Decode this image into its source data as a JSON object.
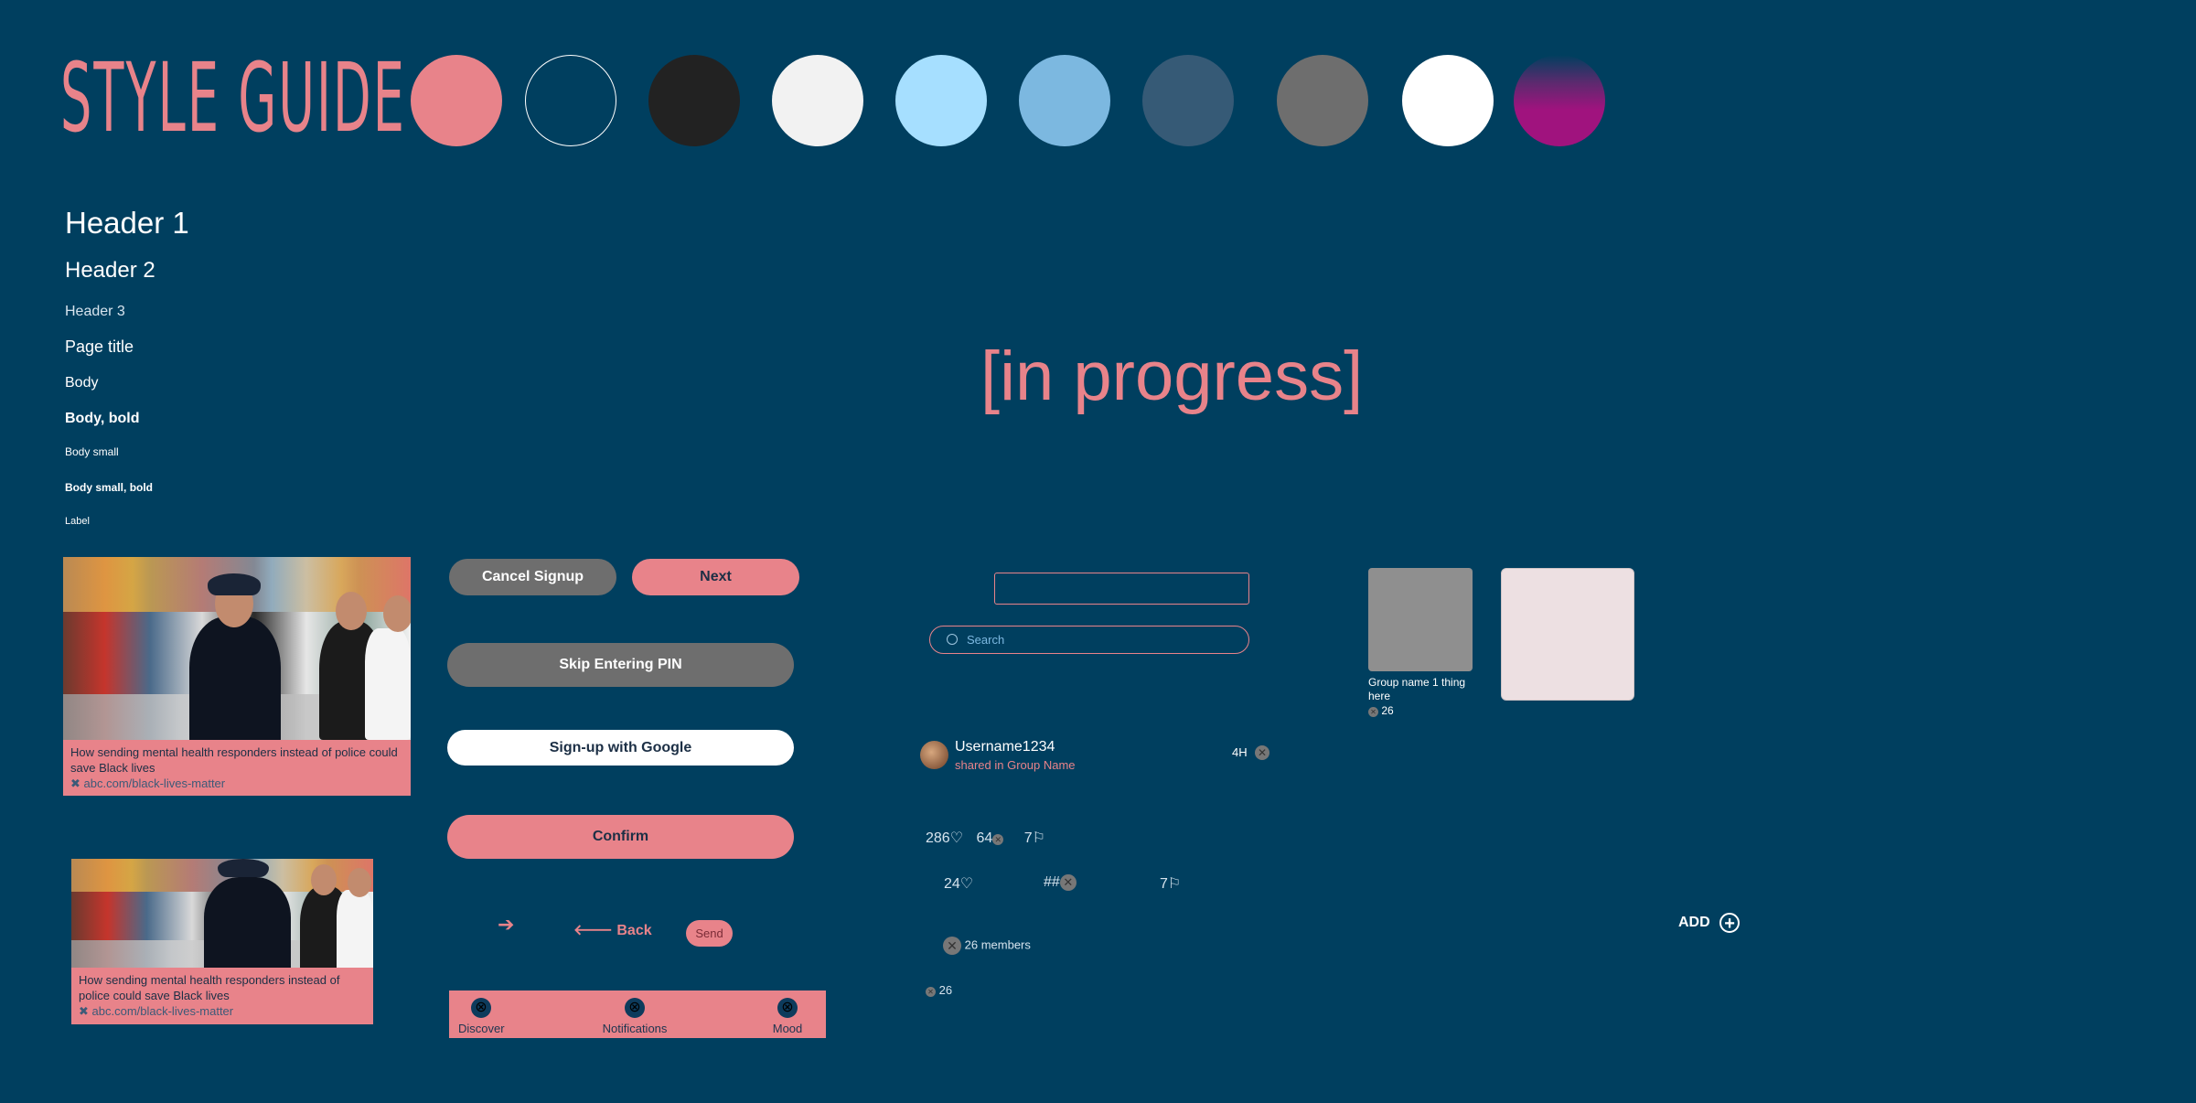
{
  "header": {
    "title": "STYLE GUIDE"
  },
  "palette": [
    "#E8838A",
    "#003F5F",
    "#222222",
    "#F2F2F2",
    "#A6DFFF",
    "#7CB8E0",
    "#365A76",
    "#6E6E6E",
    "#FFFFFF",
    "gradient:#003F5F-#A0137E"
  ],
  "typography": {
    "header1": "Header 1",
    "header2": "Header 2",
    "header3": "Header 3",
    "page_title": "Page title",
    "body": "Body",
    "body_bold": "Body, bold",
    "body_small": "Body small",
    "body_small_bold": "Body small, bold",
    "label": "Label"
  },
  "status": {
    "text": "[in progress]"
  },
  "article_card": {
    "headline": "How sending mental health responders instead of police could save Black lives",
    "link": "abc.com/black-lives-matter"
  },
  "buttons": {
    "cancel_signup": "Cancel Signup",
    "next": "Next",
    "skip_pin": "Skip Entering PIN",
    "google": "Sign-up with Google",
    "confirm": "Confirm",
    "back": "Back",
    "send": "Send",
    "add": "ADD"
  },
  "search": {
    "placeholder": "Search"
  },
  "post": {
    "username": "Username1234",
    "shared_in": "shared in Group Name",
    "time": "4H",
    "likes": "286",
    "comments": "64",
    "saves": "7",
    "row2_likes": "24",
    "row2_tags": "##",
    "row2_saves": "7"
  },
  "group": {
    "name": "Group name 1 thing here",
    "count": "26",
    "members": "26 members"
  },
  "tabs": [
    "Discover",
    "Notifications",
    "Mood"
  ],
  "colors": {
    "accent": "#E8838A",
    "background": "#003F5F",
    "button_gray": "#6E6E6E"
  }
}
